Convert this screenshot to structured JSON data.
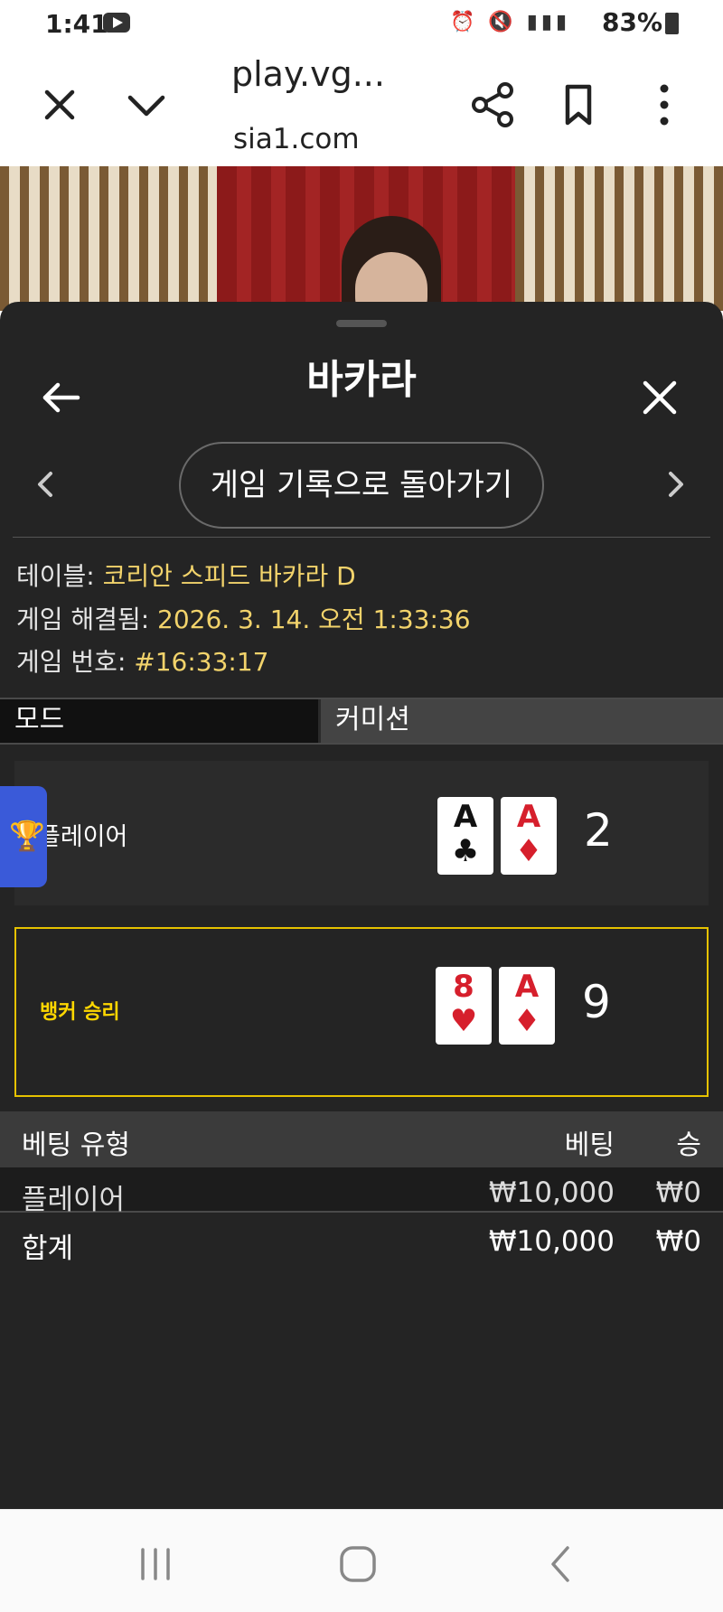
{
  "status_bar": {
    "time": "1:41",
    "battery": "83%",
    "icons": [
      "alarm-icon",
      "mute-icon",
      "volte-icon",
      "lte-icon",
      "signal-icon",
      "battery-icon"
    ]
  },
  "browser": {
    "title": "play.vg...",
    "url": "sia1.com"
  },
  "panel": {
    "title": "바카라",
    "history_button": "게임 기록으로 돌아가기",
    "info": {
      "table_label": "테이블:",
      "table_value": "코리안 스피드 바카라 D",
      "resolved_label": "게임 해결됨:",
      "resolved_value": "2026. 3. 14. 오전 1:33:36",
      "number_label": "게임 번호:",
      "number_value": "#16:33:17"
    },
    "tabs": [
      "모드",
      "커미션"
    ],
    "player": {
      "label": "플레이어",
      "cards": [
        {
          "rank": "A",
          "suit": "♣",
          "color": "black"
        },
        {
          "rank": "A",
          "suit": "♦",
          "color": "red"
        }
      ],
      "score": "2"
    },
    "banker": {
      "label": "뱅커 승리",
      "cards": [
        {
          "rank": "8",
          "suit": "♥",
          "color": "red"
        },
        {
          "rank": "A",
          "suit": "♦",
          "color": "red"
        }
      ],
      "score": "9"
    },
    "bets": {
      "headers": {
        "type": "베팅 유형",
        "bet": "베팅",
        "win": "승"
      },
      "rows": [
        {
          "type": "플레이어",
          "bet": "₩10,000",
          "win": "₩0"
        }
      ],
      "total": {
        "type": "합계",
        "bet": "₩10,000",
        "win": "₩0"
      }
    }
  },
  "colors": {
    "panel_bg": "#242424",
    "highlight": "#f2d36b",
    "win_border": "#e6c200"
  }
}
